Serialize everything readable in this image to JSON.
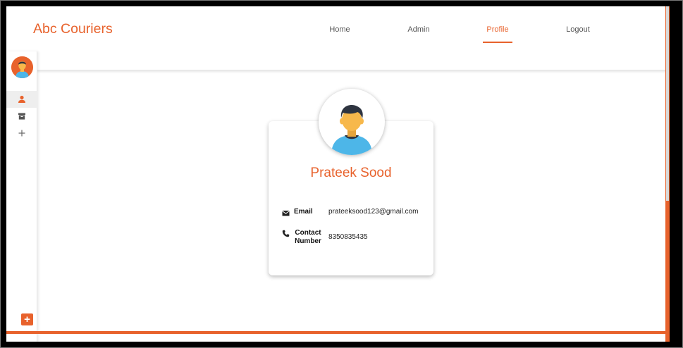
{
  "header": {
    "brand": "Abc Couriers",
    "nav": [
      {
        "label": "Home"
      },
      {
        "label": "Admin"
      },
      {
        "label": "Profile",
        "active": true
      },
      {
        "label": "Logout"
      }
    ]
  },
  "sidebar": {
    "items": [
      {
        "icon": "person-icon",
        "active": true
      },
      {
        "icon": "archive-icon",
        "active": false
      },
      {
        "icon": "plus-icon",
        "active": false
      }
    ],
    "add_button_label": "+"
  },
  "profile": {
    "name": "Prateek Sood",
    "email_label": "Email",
    "email": "prateeksood123@gmail.com",
    "contact_label": "Contact Number",
    "contact_label_line1": "Contact",
    "contact_label_line2": "Number",
    "contact": "8350835435"
  },
  "colors": {
    "accent": "#e8622c",
    "text": "#111111",
    "avatar_shirt": "#4db6e8",
    "avatar_skin": "#f7b84b",
    "avatar_hair": "#2e3440"
  }
}
